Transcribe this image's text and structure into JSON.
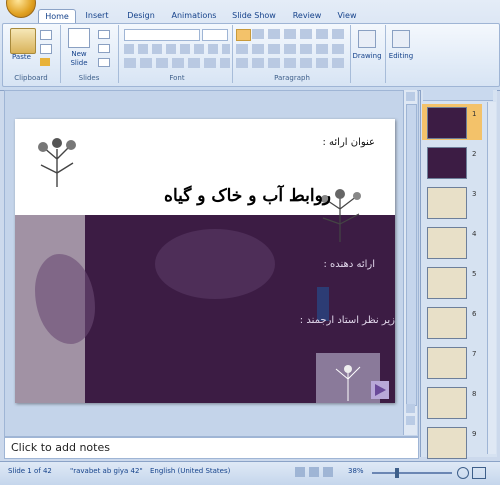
{
  "ribbon": {
    "tabs": [
      "Home",
      "Insert",
      "Design",
      "Animations",
      "Slide Show",
      "Review",
      "View"
    ],
    "active_tab": "Home",
    "groups": {
      "clipboard": {
        "label": "Clipboard",
        "paste_label": "Paste"
      },
      "slides": {
        "label": "Slides",
        "new_slide_label": "New Slide"
      },
      "font": {
        "label": "Font"
      },
      "paragraph": {
        "label": "Paragraph"
      },
      "drawing": {
        "label": "Drawing"
      },
      "editing": {
        "label": "Editing"
      }
    }
  },
  "slide": {
    "subtitle_label": "عنوان ارائه :",
    "title": "روابط آب و خاک و گیاه",
    "presenter_label": "ارائه دهنده :",
    "advisor_label": "زیر نظر استاد ارجمند :"
  },
  "notes": {
    "placeholder": "Click to add notes"
  },
  "thumbnails": [
    "1",
    "2",
    "3",
    "4",
    "5",
    "6",
    "7",
    "8",
    "9"
  ],
  "statusbar": {
    "slide_info": "Slide 1 of 42",
    "theme": "\"ravabet ab giya 42\"",
    "language": "English (United States)",
    "zoom": "38%"
  },
  "colors": {
    "accent": "#15428b",
    "slide_purple": "#3c1c44",
    "thumb_selected": "#f3c26a"
  }
}
